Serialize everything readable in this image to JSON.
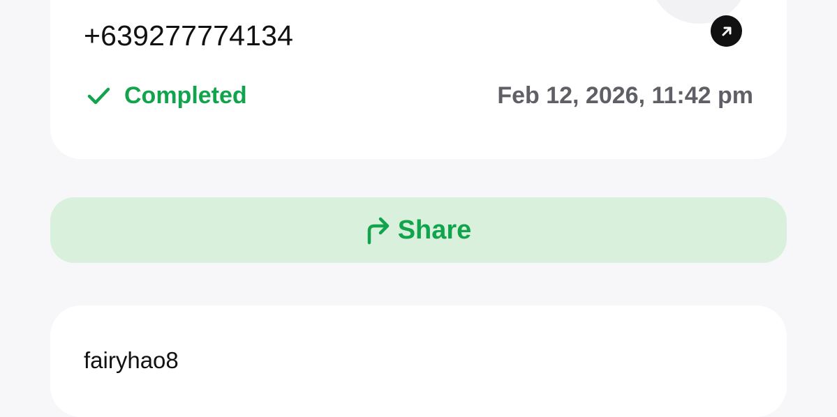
{
  "transaction": {
    "phone": "+639277774134",
    "status": "Completed",
    "timestamp": "Feb 12, 2026, 11:42 pm",
    "logo_icon": "gcash-m-logo-icon",
    "external_icon": "arrow-up-right-icon"
  },
  "actions": {
    "share_label": "Share",
    "share_icon": "share-forward-arrow-icon"
  },
  "detail": {
    "username": "fairyhao8"
  },
  "colors": {
    "accent": "#12a44c",
    "share_bg": "#d8f0dc",
    "page_bg": "#f7f7f9"
  }
}
